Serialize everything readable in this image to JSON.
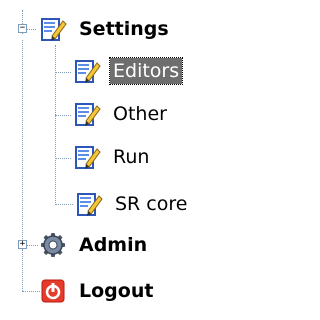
{
  "tree": {
    "nodes": [
      {
        "key": "settings",
        "label": "Settings",
        "bold": true,
        "expander": "−",
        "icon": "doc-pencil-icon"
      },
      {
        "key": "editors",
        "label": "Editors",
        "selected": true,
        "icon": "doc-pencil-icon"
      },
      {
        "key": "other",
        "label": "Other",
        "icon": "doc-pencil-icon"
      },
      {
        "key": "run",
        "label": "Run",
        "icon": "doc-pencil-icon"
      },
      {
        "key": "srcore",
        "label": "SR core",
        "icon": "doc-pencil-icon"
      },
      {
        "key": "admin",
        "label": "Admin",
        "bold": true,
        "expander": "+",
        "icon": "gear-icon"
      },
      {
        "key": "logout",
        "label": "Logout",
        "bold": true,
        "icon": "power-icon"
      }
    ]
  },
  "colors": {
    "connector": "#7f9db9",
    "selected_bg": "#6e6e6e",
    "logout_icon": "#e53b2a",
    "doc_icon_blue": "#3a6fd8",
    "pencil_yellow": "#f5c63a"
  }
}
